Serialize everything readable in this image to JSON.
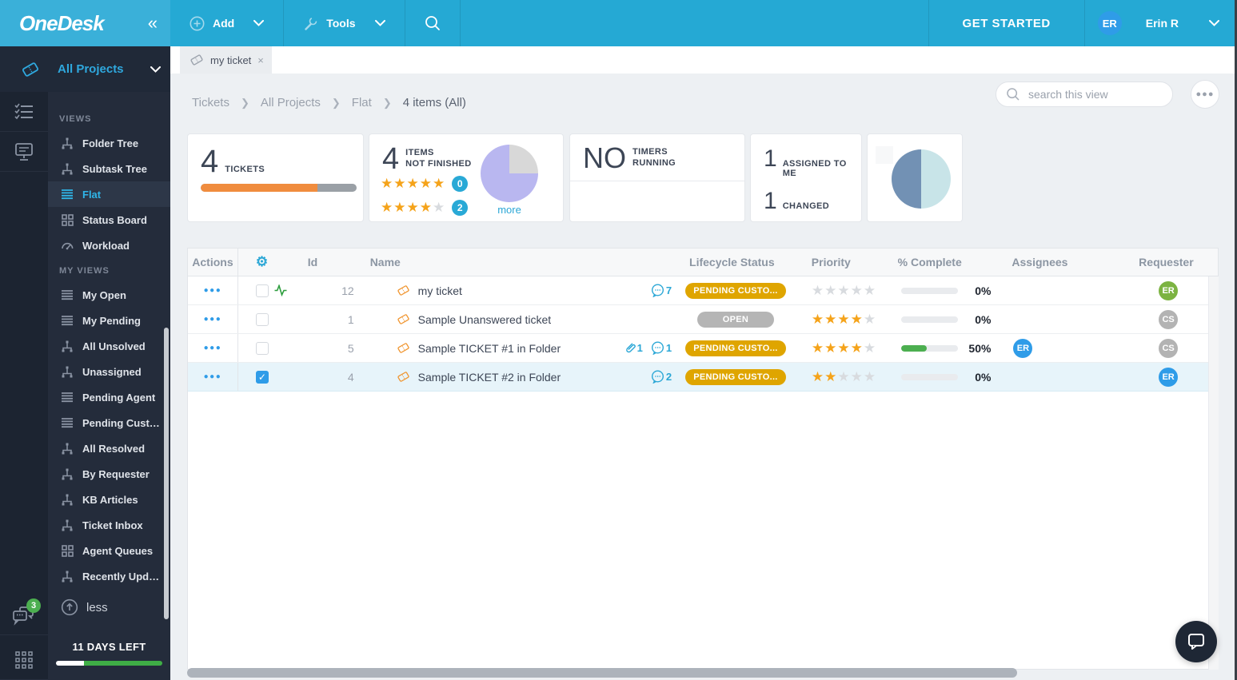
{
  "colors": {
    "topbar": "#25a9d4",
    "accent": "#2ba7d6",
    "orange": "#f08c3e",
    "star_on": "#f5a31a",
    "amber_pill": "#dfa500",
    "gray_pill": "#b5b5b5",
    "green": "#4caf50",
    "avatar_blue": "#2f9ce8",
    "avatar_green": "#7cb342",
    "avatar_gray": "#b3b3b3",
    "pie2_fill": "#b9b7f0",
    "pie2_empty": "#d8d8d8",
    "pie5_left": "#7291b4",
    "pie5_right": "#c8e4e8"
  },
  "topbar": {
    "logo": "OneDesk",
    "collapse": "«",
    "add_label": "Add",
    "tools_label": "Tools",
    "get_started": "GET STARTED",
    "user_initials": "ER",
    "user_name": "Erin R"
  },
  "tabs": [
    {
      "label": "my ticket",
      "close": "×"
    }
  ],
  "sidebar": {
    "header_label": "All Projects",
    "sections": [
      {
        "title": "VIEWS",
        "items": [
          {
            "label": "Folder Tree",
            "icon": "tree"
          },
          {
            "label": "Subtask Tree",
            "icon": "tree"
          },
          {
            "label": "Flat",
            "icon": "flat",
            "active": true
          },
          {
            "label": "Status Board",
            "icon": "board"
          },
          {
            "label": "Workload",
            "icon": "gauge"
          }
        ]
      },
      {
        "title": "MY VIEWS",
        "items": [
          {
            "label": "My Open",
            "icon": "flat"
          },
          {
            "label": "My Pending",
            "icon": "flat"
          },
          {
            "label": "All Unsolved",
            "icon": "tree"
          },
          {
            "label": "Unassigned",
            "icon": "tree"
          },
          {
            "label": "Pending Agent",
            "icon": "flat"
          },
          {
            "label": "Pending Cust…",
            "icon": "flat"
          },
          {
            "label": "All Resolved",
            "icon": "tree"
          },
          {
            "label": "By Requester",
            "icon": "tree"
          },
          {
            "label": "KB Articles",
            "icon": "tree"
          },
          {
            "label": "Ticket Inbox",
            "icon": "tree"
          },
          {
            "label": "Agent Queues",
            "icon": "board"
          },
          {
            "label": "Recently Upd…",
            "icon": "tree"
          }
        ]
      }
    ],
    "less_label": "less",
    "messages_badge": "3",
    "trial": {
      "label": "11 DAYS LEFT",
      "white_pct": 26,
      "green_pct": 74
    }
  },
  "breadcrumb": {
    "items": [
      "Tickets",
      "All Projects",
      "Flat"
    ],
    "current": "4 items (All)"
  },
  "view_search": {
    "placeholder": "search this view"
  },
  "cards": {
    "tickets": {
      "value": "4",
      "label": "TICKETS",
      "bar_pct": 75
    },
    "not_finished": {
      "value": "4",
      "label_line1": "ITEMS",
      "label_line2": "NOT FINISHED",
      "ratings": [
        {
          "stars": 5,
          "count": "0"
        },
        {
          "stars": 4,
          "count": "2"
        }
      ],
      "more_label": "more",
      "pie_filled_pct": 75
    },
    "timers": {
      "value": "NO",
      "label_line1": "TIMERS",
      "label_line2": "RUNNING"
    },
    "my_stats": [
      {
        "value": "1",
        "label": "ASSIGNED TO ME"
      },
      {
        "value": "1",
        "label": "CHANGED"
      }
    ],
    "half_pie": {
      "left_pct": 50
    }
  },
  "table": {
    "headers": {
      "actions": "Actions",
      "id": "Id",
      "name": "Name",
      "status": "Lifecycle Status",
      "priority": "Priority",
      "complete": "% Complete",
      "assignees": "Assignees",
      "requester": "Requester"
    },
    "rows": [
      {
        "id": "12",
        "name": "my ticket",
        "activity": true,
        "checked": false,
        "selected": false,
        "comments": "7",
        "attachments": null,
        "status": {
          "label": "PENDING CUSTO...",
          "type": "amber"
        },
        "priority": 0,
        "complete_pct": 0,
        "complete_label": "0%",
        "assignees": [],
        "requester": {
          "initials": "ER",
          "color": "green"
        }
      },
      {
        "id": "1",
        "name": "Sample Unanswered ticket",
        "activity": false,
        "checked": false,
        "selected": false,
        "comments": null,
        "attachments": null,
        "status": {
          "label": "OPEN",
          "type": "gray"
        },
        "priority": 4,
        "complete_pct": 0,
        "complete_label": "0%",
        "assignees": [],
        "requester": {
          "initials": "CS",
          "color": "gray"
        }
      },
      {
        "id": "5",
        "name": "Sample TICKET #1 in Folder",
        "activity": false,
        "checked": false,
        "selected": false,
        "comments": "1",
        "attachments": "1",
        "status": {
          "label": "PENDING CUSTO...",
          "type": "amber"
        },
        "priority": 4,
        "complete_pct": 45,
        "complete_label": "50%",
        "assignees": [
          {
            "initials": "ER",
            "color": "blue"
          }
        ],
        "requester": {
          "initials": "CS",
          "color": "gray"
        }
      },
      {
        "id": "4",
        "name": "Sample TICKET #2 in Folder",
        "activity": false,
        "checked": true,
        "selected": true,
        "comments": "2",
        "attachments": null,
        "status": {
          "label": "PENDING CUSTO...",
          "type": "amber"
        },
        "priority": 2,
        "complete_pct": 0,
        "complete_label": "0%",
        "assignees": [],
        "requester": {
          "initials": "ER",
          "color": "blue"
        }
      }
    ]
  }
}
